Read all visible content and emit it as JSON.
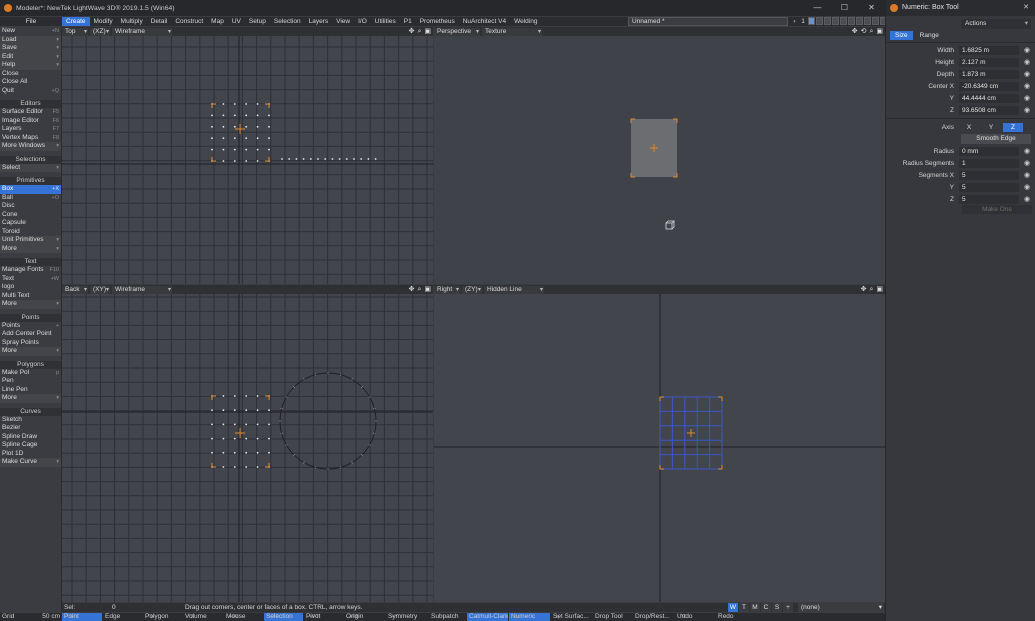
{
  "window": {
    "title": "Modeler*: NewTek LightWave 3D® 2019.1.5 (Win64)",
    "controls": [
      "—",
      "☐",
      "✕"
    ]
  },
  "menubar": {
    "file_label": "File",
    "menus": [
      "Create",
      "Modify",
      "Multiply",
      "Detail",
      "Construct",
      "Map",
      "UV",
      "Setup",
      "Selection",
      "Layers",
      "View",
      "I/O",
      "Utilities",
      "P1",
      "Prometheus",
      "NuArchitect V4",
      "Welding"
    ],
    "active_menu": "Create",
    "layer_name": "Unnamed *",
    "layer_number": "1"
  },
  "sidebar": {
    "file_items": [
      {
        "label": "New",
        "shortcut": "+N"
      },
      {
        "label": "Load",
        "shortcut": "+O",
        "dropdown": true
      },
      {
        "label": "Save",
        "shortcut": "",
        "dropdown": true
      },
      {
        "label": "Edit",
        "shortcut": "",
        "dropdown": true
      },
      {
        "label": "Help",
        "shortcut": "",
        "dropdown": true
      },
      {
        "label": "Close",
        "shortcut": ""
      },
      {
        "label": "Close All",
        "shortcut": ""
      },
      {
        "label": "Quit",
        "shortcut": "+Q"
      }
    ],
    "editors_title": "Editors",
    "editors_items": [
      {
        "label": "Surface Editor",
        "shortcut": "F5"
      },
      {
        "label": "Image Editor",
        "shortcut": "F6"
      },
      {
        "label": "Layers",
        "shortcut": "F7"
      },
      {
        "label": "Vertex Maps",
        "shortcut": "F8"
      },
      {
        "label": "More Windows",
        "shortcut": "",
        "dropdown": true
      }
    ],
    "selections_title": "Selections",
    "selections_items": [
      {
        "label": "Select",
        "shortcut": "",
        "dropdown": true
      }
    ],
    "primitives_title": "Primitives",
    "primitives_items": [
      {
        "label": "Box",
        "shortcut": "+X",
        "selected": true
      },
      {
        "label": "Ball",
        "shortcut": "+O"
      },
      {
        "label": "Disc",
        "shortcut": ""
      },
      {
        "label": "Cone",
        "shortcut": ""
      },
      {
        "label": "Capsule",
        "shortcut": ""
      },
      {
        "label": "Toroid",
        "shortcut": ""
      },
      {
        "label": "Unit Primitives",
        "shortcut": "",
        "dropdown": true
      },
      {
        "label": "More",
        "shortcut": "",
        "dropdown": true
      }
    ],
    "text_title": "Text",
    "text_items": [
      {
        "label": "Manage Fonts",
        "shortcut": "F10"
      },
      {
        "label": "Text",
        "shortcut": "+W"
      },
      {
        "label": "logo",
        "shortcut": ""
      },
      {
        "label": "Multi Text",
        "shortcut": ""
      },
      {
        "label": "More",
        "shortcut": "",
        "dropdown": true
      }
    ],
    "points_title": "Points",
    "points_items": [
      {
        "label": "Points",
        "shortcut": "+"
      },
      {
        "label": "Add Center Point",
        "shortcut": ""
      },
      {
        "label": "Spray Points",
        "shortcut": ""
      },
      {
        "label": "More",
        "shortcut": "",
        "dropdown": true
      }
    ],
    "polygons_title": "Polygons",
    "polygons_items": [
      {
        "label": "Make Pol",
        "shortcut": "p"
      },
      {
        "label": "Pen",
        "shortcut": ""
      },
      {
        "label": "Line Pen",
        "shortcut": ""
      },
      {
        "label": "More",
        "shortcut": "",
        "dropdown": true
      }
    ],
    "curves_title": "Curves",
    "curves_items": [
      {
        "label": "Sketch",
        "shortcut": ""
      },
      {
        "label": "Bezier",
        "shortcut": ""
      },
      {
        "label": "Spline Draw",
        "shortcut": ""
      },
      {
        "label": "Spline Cage",
        "shortcut": ""
      },
      {
        "label": "Plot 1D",
        "shortcut": ""
      },
      {
        "label": "Make Curve",
        "shortcut": "",
        "dropdown": true
      }
    ],
    "grid_label": "Grid",
    "grid_value": "50 cm"
  },
  "viewports": {
    "top_left": {
      "view": "Top",
      "axis": "(XZ)",
      "mode": "Wireframe"
    },
    "top_right": {
      "view": "Perspective",
      "mode": "Texture"
    },
    "bottom_left": {
      "view": "Back",
      "axis": "(XY)",
      "mode": "Wireframe"
    },
    "bottom_right": {
      "view": "Right",
      "axis": "(ZY)",
      "mode": "Hidden Line"
    },
    "icons": {
      "move": "✥",
      "rotate": "⟲",
      "zoom": "🔍",
      "maximize": "▣"
    }
  },
  "numeric_panel": {
    "title": "Numeric: Box Tool",
    "actions_label": "Actions",
    "tabs": [
      "Size",
      "Range"
    ],
    "active_tab": "Size",
    "fields": [
      {
        "label": "Width",
        "value": "1.6825 m"
      },
      {
        "label": "Height",
        "value": "2.127 m"
      },
      {
        "label": "Depth",
        "value": "1.873 m"
      },
      {
        "label": "Center X",
        "value": "-20.6349 cm"
      },
      {
        "label": "Y",
        "value": "44.4444 cm"
      },
      {
        "label": "Z",
        "value": "93.6508 cm"
      }
    ],
    "axis_label": "Axis",
    "axis_options": [
      "X",
      "Y",
      "Z"
    ],
    "axis_selected": "Z",
    "smooth_edge_label": "Smooth Edge",
    "fields2": [
      {
        "label": "Radius",
        "value": "0 mm"
      },
      {
        "label": "Radius Segments",
        "value": "1"
      },
      {
        "label": "Segments X",
        "value": "5"
      },
      {
        "label": "Y",
        "value": "5"
      },
      {
        "label": "Z",
        "value": "5"
      }
    ],
    "make_one_label": "Make One",
    "eye_icon": "◉"
  },
  "status": {
    "sel_label": "Sel:",
    "sel_value": "0",
    "hint": "Drag out corners, center or faces of a box. CTRL, arrow keys.",
    "wtmcs": [
      "W",
      "T",
      "M",
      "C",
      "S",
      "+"
    ],
    "wtmcs_active": "W",
    "surface_value": "(none)"
  },
  "bottombar": {
    "items": [
      {
        "label": "Point",
        "shortcut": "^G",
        "on": true
      },
      {
        "label": "Edge",
        "shortcut": ""
      },
      {
        "label": "Polygon",
        "shortcut": "^H"
      },
      {
        "label": "Volume",
        "shortcut": "^J"
      },
      {
        "label": "Mouse",
        "shortcut": "+F6"
      },
      {
        "label": "Selection",
        "shortcut": "+F6",
        "on": true
      },
      {
        "label": "Pivot",
        "shortcut": "+F7"
      },
      {
        "label": "Origin",
        "shortcut": "+F8"
      },
      {
        "label": "Symmetry",
        "shortcut": "+Y"
      },
      {
        "label": "Subpatch",
        "shortcut": ""
      },
      {
        "label": "Catmull-Clark",
        "shortcut": "",
        "on": true
      },
      {
        "label": "Numeric",
        "shortcut": "n",
        "on": true
      },
      {
        "label": "Set Surfac...",
        "shortcut": "q"
      },
      {
        "label": "Drop Tool",
        "shortcut": ""
      },
      {
        "label": "Drop/Rest...",
        "shortcut": ""
      },
      {
        "label": "Undo",
        "shortcut": "^Z"
      },
      {
        "label": "Redo",
        "shortcut": ""
      }
    ]
  },
  "colors": {
    "accent": "#3573d6",
    "viewport_bg": "#43454c",
    "grid_line": "#2f3036",
    "axis_line": "#1e1f23",
    "mesh_blue": "#3b56c8",
    "handle_orange": "#e08a2e",
    "point_white": "#e6e6e6",
    "persp_box": "#6c6d70"
  }
}
